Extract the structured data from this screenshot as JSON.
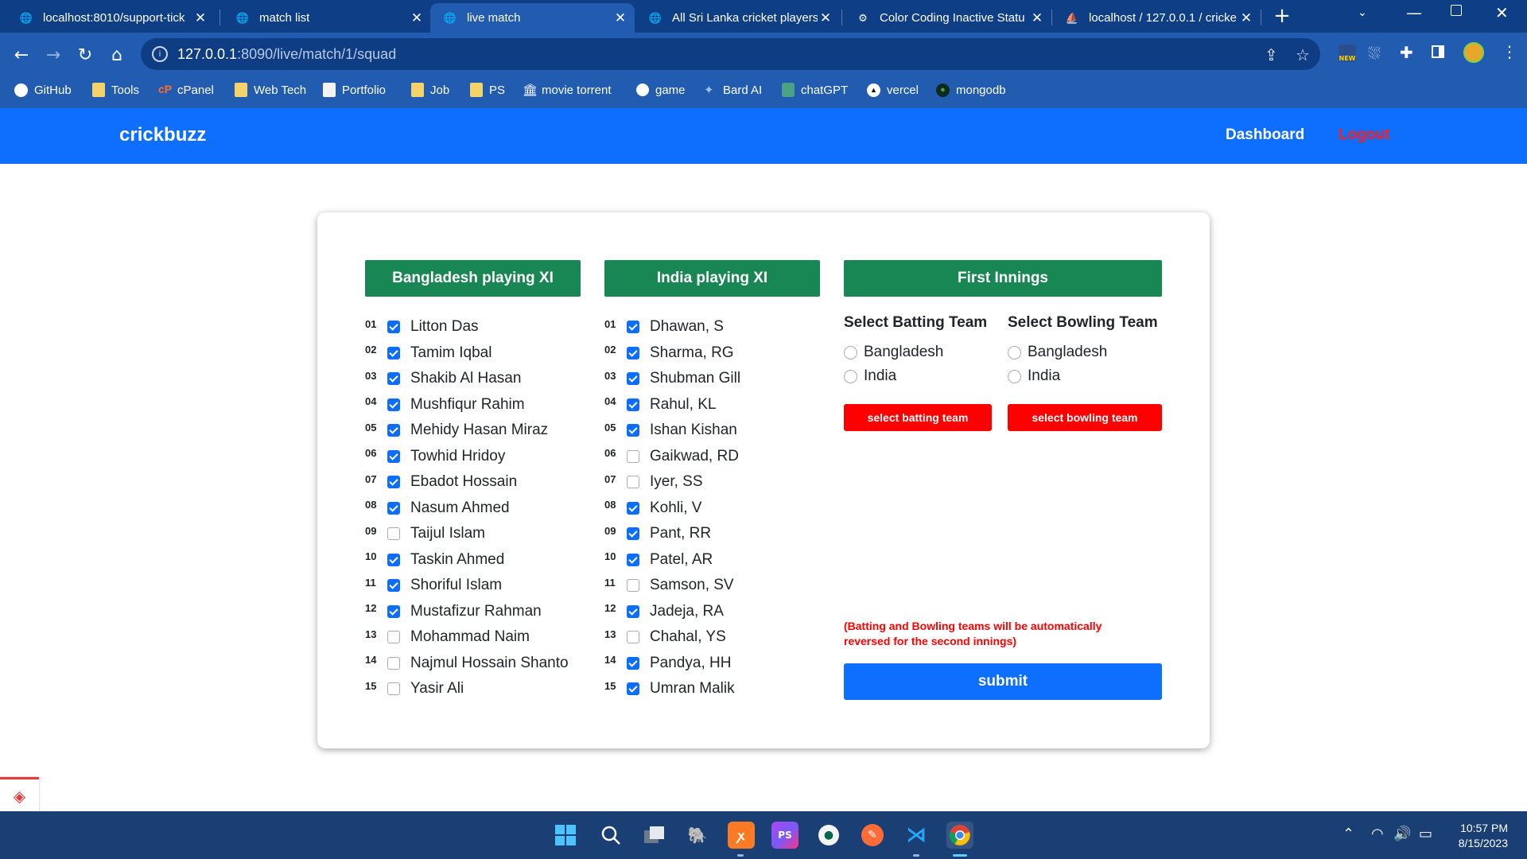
{
  "browser": {
    "tabs": [
      {
        "title": "localhost:8010/support-tick",
        "icon": "globe-icon"
      },
      {
        "title": "match list",
        "icon": "globe-icon"
      },
      {
        "title": "live match",
        "icon": "globe-icon",
        "active": true
      },
      {
        "title": "All Sri Lanka cricket players,",
        "icon": "globe-icon"
      },
      {
        "title": "Color Coding Inactive Statu",
        "icon": "chatgpt-icon"
      },
      {
        "title": "localhost / 127.0.0.1 / cricke",
        "icon": "phpmyadmin-icon"
      }
    ],
    "new_tab_symbol": "+",
    "address": {
      "host": "127.0.0.1",
      "path": ":8090/live/match/1/squad"
    },
    "bookmarks": [
      {
        "label": "GitHub",
        "icon": "github-icon"
      },
      {
        "label": "Tools",
        "icon": "folder-icon"
      },
      {
        "label": "cPanel",
        "icon": "cpanel-icon"
      },
      {
        "label": "Web Tech",
        "icon": "folder-icon"
      },
      {
        "label": "Portfolio",
        "icon": "portfolio-icon"
      },
      {
        "label": "Job",
        "icon": "folder-icon"
      },
      {
        "label": "PS",
        "icon": "folder-icon"
      },
      {
        "label": "movie torrent",
        "icon": "building-icon"
      },
      {
        "label": "game",
        "icon": "game-icon"
      },
      {
        "label": "Bard AI",
        "icon": "bard-icon"
      },
      {
        "label": "chatGPT",
        "icon": "chatgpt-icon"
      },
      {
        "label": "vercel",
        "icon": "vercel-icon"
      },
      {
        "label": "mongodb",
        "icon": "mongodb-icon"
      }
    ]
  },
  "site": {
    "brand": "crickbuzz",
    "nav": {
      "dashboard": "Dashboard",
      "logout": "Logout"
    }
  },
  "squad": {
    "team1": {
      "header": "Bangladesh playing XI",
      "players": [
        {
          "num": "01",
          "name": "Litton Das",
          "checked": true
        },
        {
          "num": "02",
          "name": "Tamim Iqbal",
          "checked": true
        },
        {
          "num": "03",
          "name": "Shakib Al Hasan",
          "checked": true
        },
        {
          "num": "04",
          "name": "Mushfiqur Rahim",
          "checked": true
        },
        {
          "num": "05",
          "name": "Mehidy Hasan Miraz",
          "checked": true
        },
        {
          "num": "06",
          "name": "Towhid Hridoy",
          "checked": true
        },
        {
          "num": "07",
          "name": "Ebadot Hossain",
          "checked": true
        },
        {
          "num": "08",
          "name": "Nasum Ahmed",
          "checked": true
        },
        {
          "num": "09",
          "name": "Taijul Islam",
          "checked": false
        },
        {
          "num": "10",
          "name": "Taskin Ahmed",
          "checked": true
        },
        {
          "num": "11",
          "name": "Shoriful Islam",
          "checked": true
        },
        {
          "num": "12",
          "name": "Mustafizur Rahman",
          "checked": true
        },
        {
          "num": "13",
          "name": "Mohammad Naim",
          "checked": false
        },
        {
          "num": "14",
          "name": "Najmul Hossain Shanto",
          "checked": false
        },
        {
          "num": "15",
          "name": "Yasir Ali",
          "checked": false
        }
      ]
    },
    "team2": {
      "header": "India playing XI",
      "players": [
        {
          "num": "01",
          "name": "Dhawan, S",
          "checked": true
        },
        {
          "num": "02",
          "name": "Sharma, RG",
          "checked": true
        },
        {
          "num": "03",
          "name": "Shubman Gill",
          "checked": true
        },
        {
          "num": "04",
          "name": "Rahul, KL",
          "checked": true
        },
        {
          "num": "05",
          "name": "Ishan Kishan",
          "checked": true
        },
        {
          "num": "06",
          "name": "Gaikwad, RD",
          "checked": false
        },
        {
          "num": "07",
          "name": "Iyer, SS",
          "checked": false
        },
        {
          "num": "08",
          "name": "Kohli, V",
          "checked": true
        },
        {
          "num": "09",
          "name": "Pant, RR",
          "checked": true
        },
        {
          "num": "10",
          "name": "Patel, AR",
          "checked": true
        },
        {
          "num": "11",
          "name": "Samson, SV",
          "checked": false
        },
        {
          "num": "12",
          "name": "Jadeja, RA",
          "checked": true
        },
        {
          "num": "13",
          "name": "Chahal, YS",
          "checked": false
        },
        {
          "num": "14",
          "name": "Pandya, HH",
          "checked": true
        },
        {
          "num": "15",
          "name": "Umran Malik",
          "checked": true
        }
      ]
    },
    "innings": {
      "header": "First Innings",
      "batting_title": "Select Batting Team",
      "bowling_title": "Select Bowling Team",
      "batting_options": [
        "Bangladesh",
        "India"
      ],
      "bowling_options": [
        "Bangladesh",
        "India"
      ],
      "batting_button": "select batting team",
      "bowling_button": "select bowling team",
      "note": "(Batting and Bowling teams will be automatically reversed for the second innings)",
      "submit": "submit"
    }
  },
  "taskbar": {
    "apps": [
      "windows-start-icon",
      "search-icon",
      "task-view-icon",
      "postgresql-icon",
      "xampp-icon",
      "phpstorm-icon",
      "mongodb-compass-icon",
      "postman-icon",
      "vscode-icon",
      "chrome-icon"
    ],
    "time": "10:57 PM",
    "date": "8/15/2023"
  },
  "colors": {
    "site_nav": "#0e6fff",
    "green_header": "#198754",
    "red_button": "#ff0000",
    "submit": "#0e6efd",
    "checkbox_checked": "#0d6efd"
  }
}
